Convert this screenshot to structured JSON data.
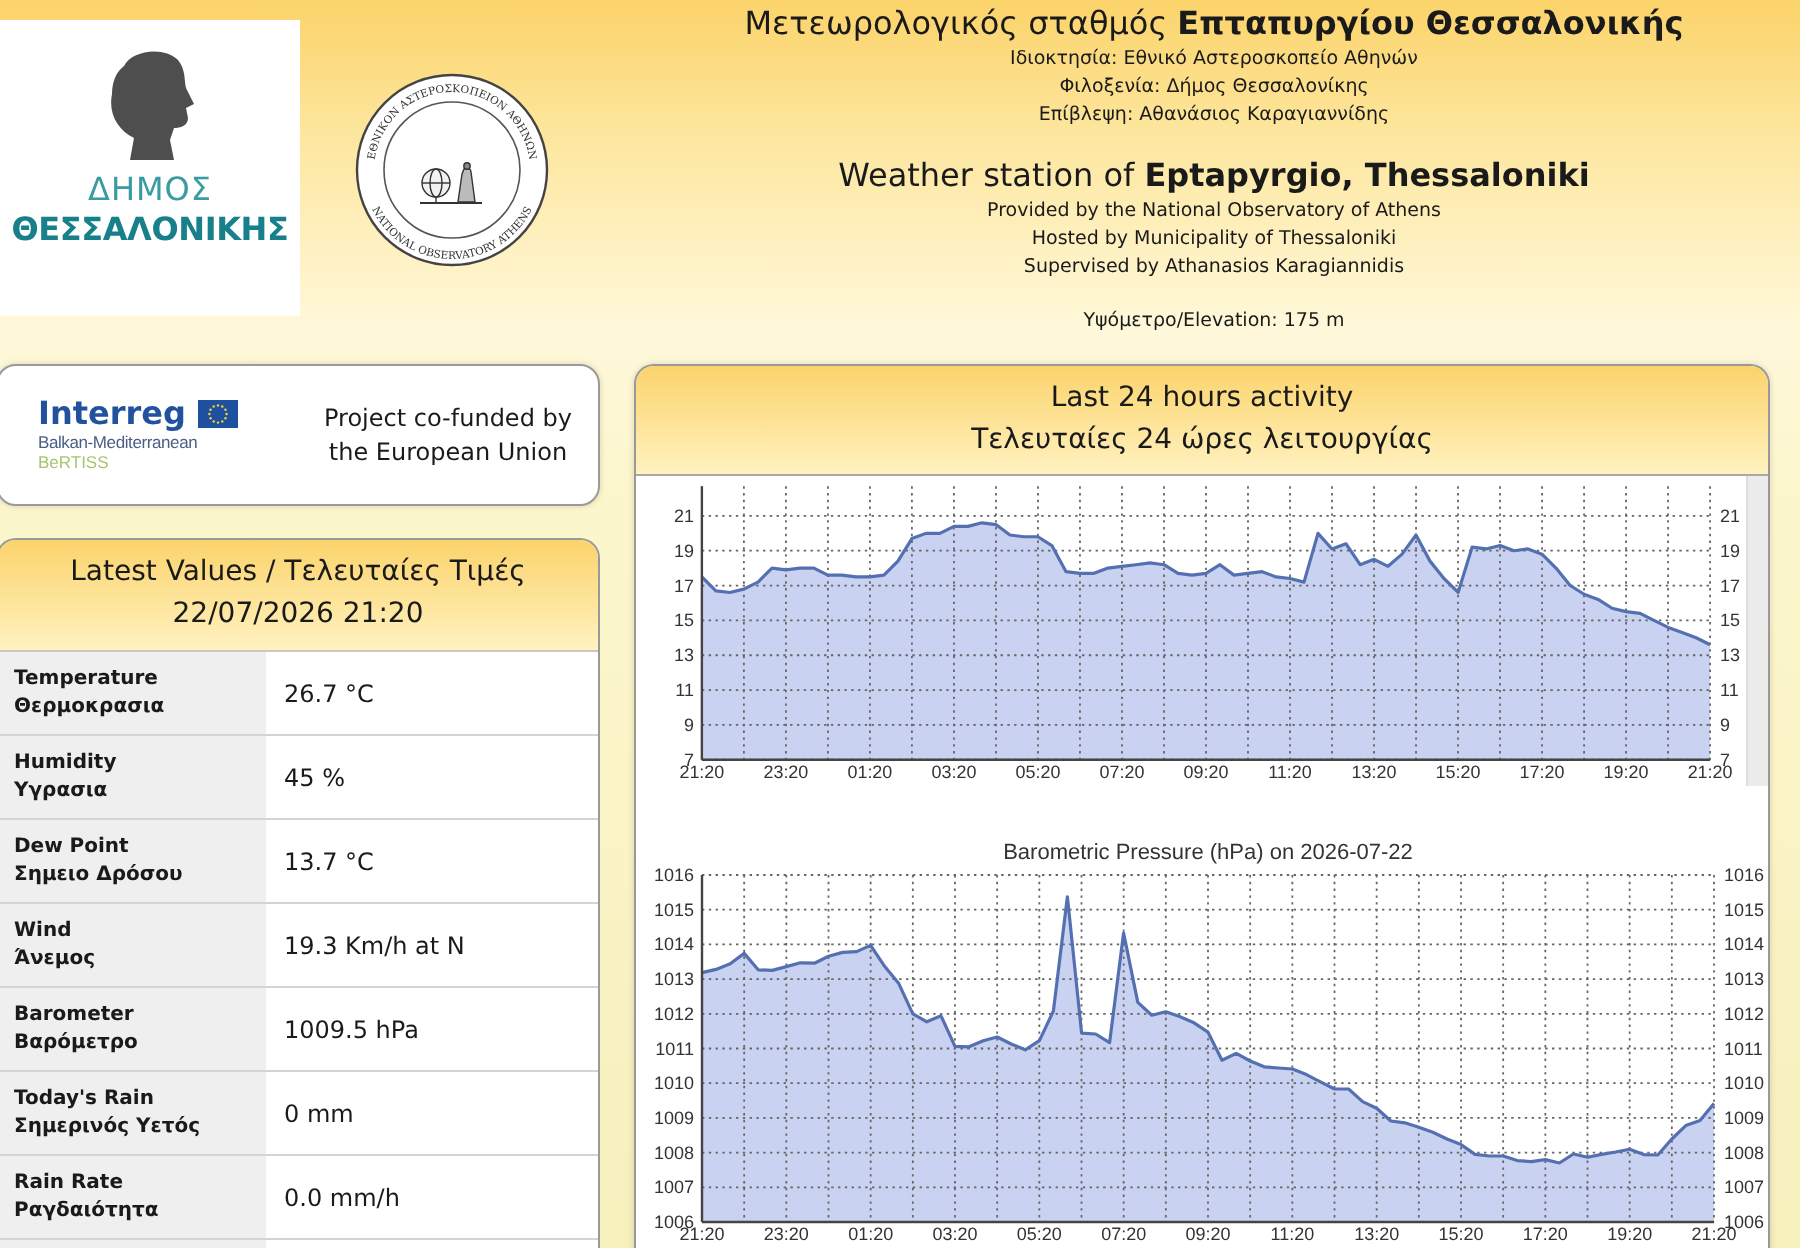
{
  "header": {
    "municipality_logo": {
      "line_1": "ΔΗΜΟΣ",
      "line_2": "ΘΕΣΣΑΛΟΝΙΚΗΣ"
    },
    "observatory_seal": {
      "text_top": "ΕΘΝΙΚΟΝ ΑΣΤΕΡΟΣΚΟΠΕΙΟΝ ΑΘΗΝΩΝ",
      "text_bottom": "NATIONAL OBSERVATORY ATHENS"
    },
    "greek": {
      "title": "Μετεωρολογικός σταθμός **Επταπυργίου Θεσσαλονικής**",
      "lines": [
        "Ιδιοκτησία: Εθνικό Αστεροσκοπείο Αθηνών",
        "Φιλοξενία: Δήμος Θεσσαλονίκης",
        "Επίβλεψη: Αθανάσιος Καραγιαννίδης"
      ]
    },
    "english": {
      "title": "Weather station of **Eptapyrgio, Thessaloniki**",
      "lines": [
        "Provided by the National Observatory of Athens",
        "Hosted by Municipality of Thessaloniki",
        "Supervised by Athanasios Karagiannidis"
      ]
    },
    "elevation": "Υψόμετρο/Elevation: 175 m"
  },
  "funding": {
    "logo": {
      "wordmark": "Interreg",
      "programme": "Balkan-Mediterranean",
      "project": "BeRTISS"
    },
    "text": "Project co-funded by the European Union"
  },
  "latest_values": {
    "title": "Latest Values / Τελευταίες Τιμές",
    "timestamp": "22/07/2026 21:20",
    "rows": [
      {
        "label_en": "Temperature",
        "label_el": "Θερμοκρασια",
        "value": "26.7 °C"
      },
      {
        "label_en": "Humidity",
        "label_el": "Υγρασια",
        "value": "45 %"
      },
      {
        "label_en": "Dew Point",
        "label_el": "Σημειο Δρόσου",
        "value": "13.7 °C"
      },
      {
        "label_en": "Wind",
        "label_el": "Άνεμος",
        "value": "19.3 Km/h at N"
      },
      {
        "label_en": "Barometer",
        "label_el": "Βαρόμετρο",
        "value": "1009.5 hPa"
      },
      {
        "label_en": "Today's Rain",
        "label_el": "Σημερινός Υετός",
        "value": "0 mm"
      },
      {
        "label_en": "Rain Rate",
        "label_el": "Ραγδαιότητα",
        "value": "0.0 mm/h"
      }
    ]
  },
  "activity": {
    "title": "Last 24 hours activity",
    "title_el": "Τελευταίες 24 ώρες λειτουργίας",
    "charts": [
      {
        "chart_data": {
          "type": "area",
          "grid": true,
          "categories": [
            "21:20",
            null,
            null,
            null,
            null,
            null,
            "23:20",
            null,
            null,
            null,
            null,
            null,
            "01:20",
            null,
            null,
            null,
            null,
            null,
            "03:20",
            null,
            null,
            null,
            null,
            null,
            "05:20",
            null,
            null,
            null,
            null,
            null,
            "07:20",
            null,
            null,
            null,
            null,
            null,
            "09:20",
            null,
            null,
            null,
            null,
            null,
            "11:20",
            null,
            null,
            null,
            null,
            null,
            "13:20",
            null,
            null,
            null,
            null,
            null,
            "15:20",
            null,
            null,
            null,
            null,
            null,
            "17:20",
            null,
            null,
            null,
            null,
            null,
            "19:20",
            null,
            null,
            null,
            null,
            null,
            "21:20"
          ],
          "values": [
            17.5,
            16.7,
            16.6,
            16.8,
            17.2,
            18.0,
            17.9,
            18.0,
            18.0,
            17.6,
            17.6,
            17.5,
            17.5,
            17.6,
            18.4,
            19.7,
            20.0,
            20.0,
            20.4,
            20.4,
            20.6,
            20.5,
            19.9,
            19.8,
            19.8,
            19.3,
            17.8,
            17.7,
            17.7,
            18.0,
            18.1,
            18.2,
            18.3,
            18.2,
            17.7,
            17.6,
            17.7,
            18.2,
            17.6,
            17.7,
            17.8,
            17.5,
            17.4,
            17.2,
            20.0,
            19.1,
            19.4,
            18.2,
            18.5,
            18.1,
            18.8,
            19.9,
            18.4,
            17.4,
            16.6,
            19.2,
            19.1,
            19.3,
            19.0,
            19.1,
            18.8,
            18.0,
            17.0,
            16.5,
            16.2,
            15.7,
            15.5,
            15.4,
            15.0,
            14.6,
            14.3,
            14.0,
            13.6
          ],
          "ylim": [
            7,
            22.7
          ],
          "yticks": [
            7,
            9,
            11,
            13,
            15,
            17,
            19,
            21
          ]
        },
        "right_axis_labels": [
          "21",
          "19",
          "17",
          "15",
          "13",
          "11",
          "9",
          "7"
        ]
      },
      {
        "chart_data": {
          "type": "area",
          "grid": true,
          "title": "Barometric Pressure (hPa) on 2026-07-22",
          "categories": [
            "21:20",
            null,
            null,
            null,
            null,
            null,
            "23:20",
            null,
            null,
            null,
            null,
            null,
            "01:20",
            null,
            null,
            null,
            null,
            null,
            "03:20",
            null,
            null,
            null,
            null,
            null,
            "05:20",
            null,
            null,
            null,
            null,
            null,
            "07:20",
            null,
            null,
            null,
            null,
            null,
            "09:20",
            null,
            null,
            null,
            null,
            null,
            "11:20",
            null,
            null,
            null,
            null,
            null,
            "13:20",
            null,
            null,
            null,
            null,
            null,
            "15:20",
            null,
            null,
            null,
            null,
            null,
            "17:20",
            null,
            null,
            null,
            null,
            null,
            "19:20",
            null,
            null,
            null,
            null,
            null,
            "21:20"
          ],
          "values": [
            1013.19,
            1013.28,
            1013.44,
            1013.74,
            1013.27,
            1013.25,
            1013.36,
            1013.47,
            1013.46,
            1013.66,
            1013.77,
            1013.79,
            1013.97,
            1013.36,
            1012.87,
            1012.0,
            1011.77,
            1011.94,
            1011.06,
            1011.05,
            1011.22,
            1011.33,
            1011.13,
            1010.96,
            1011.23,
            1012.08,
            1015.37,
            1011.44,
            1011.42,
            1011.17,
            1014.33,
            1012.33,
            1011.96,
            1012.06,
            1011.92,
            1011.74,
            1011.47,
            1010.66,
            1010.86,
            1010.64,
            1010.47,
            1010.44,
            1010.41,
            1010.25,
            1010.04,
            1009.83,
            1009.83,
            1009.47,
            1009.28,
            1008.91,
            1008.86,
            1008.73,
            1008.59,
            1008.39,
            1008.23,
            1007.95,
            1007.9,
            1007.9,
            1007.77,
            1007.74,
            1007.8,
            1007.7,
            1007.96,
            1007.87,
            1007.95,
            1008.02,
            1008.1,
            1007.94,
            1007.93,
            1008.39,
            1008.78,
            1008.92,
            1009.42
          ],
          "ylim": [
            1006,
            1016
          ],
          "yticks": [
            1006,
            1007,
            1008,
            1009,
            1010,
            1011,
            1012,
            1013,
            1014,
            1015,
            1016
          ]
        },
        "right_axis_labels": [
          "1016",
          "1015",
          "1014",
          "1013",
          "1012",
          "1011",
          "1010",
          "1009",
          "1008",
          "1007",
          "1006"
        ]
      }
    ]
  }
}
